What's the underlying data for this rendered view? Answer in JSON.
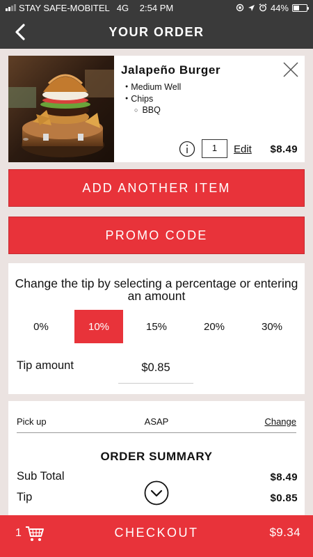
{
  "status_bar": {
    "carrier": "STAY SAFE-MOBITEL",
    "network": "4G",
    "time": "2:54 PM",
    "battery": "44%",
    "battery_level": 0.44
  },
  "header": {
    "title": "YOUR ORDER"
  },
  "order_item": {
    "name": "Jalapeño Burger",
    "modifiers": [
      "Medium Well",
      "Chips"
    ],
    "sub_modifier": "BBQ",
    "quantity": "1",
    "edit_label": "Edit",
    "price": "$8.49"
  },
  "actions": {
    "add_item_label": "ADD ANOTHER ITEM",
    "promo_label": "PROMO CODE"
  },
  "tip": {
    "heading": "Change the tip by selecting a percentage or entering an amount",
    "options": [
      "0%",
      "10%",
      "15%",
      "20%",
      "30%"
    ],
    "selected": "10%",
    "amount_label": "Tip amount",
    "amount_value": "$0.85"
  },
  "summary": {
    "pickup_label": "Pick up",
    "pickup_value": "ASAP",
    "change_label": "Change",
    "title": "ORDER SUMMARY",
    "subtotal_label": "Sub Total",
    "subtotal_value": "$8.49",
    "tip_label": "Tip",
    "tip_value": "$0.85"
  },
  "checkout": {
    "cart_count": "1",
    "label": "CHECKOUT",
    "total": "$9.34"
  },
  "colors": {
    "accent": "#e8333a",
    "header_bg": "#3a3a3a",
    "page_bg": "#ebe3e1"
  }
}
